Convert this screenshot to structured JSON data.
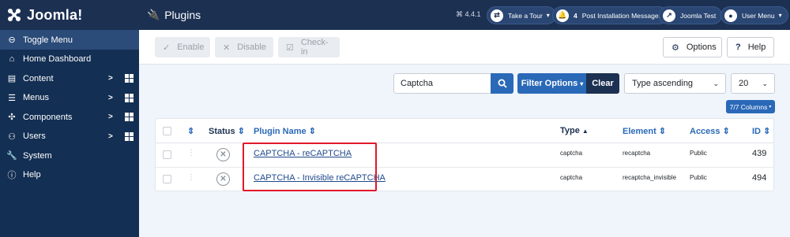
{
  "app": {
    "logo_text": "Joomla!",
    "page_title": "Plugins",
    "version": "⌘ 4.4.1"
  },
  "header_buttons": {
    "tour": "Take a Tour",
    "post_install_count": "4",
    "post_install": "Post Installation Messages",
    "site": "Joomla Test",
    "user_menu": "User Menu"
  },
  "sidebar": {
    "items": [
      {
        "label": "Toggle Menu",
        "icon": "toggle-icon"
      },
      {
        "label": "Home Dashboard",
        "icon": "home-icon"
      },
      {
        "label": "Content",
        "icon": "file-icon"
      },
      {
        "label": "Menus",
        "icon": "list-icon"
      },
      {
        "label": "Components",
        "icon": "puzzle-icon"
      },
      {
        "label": "Users",
        "icon": "users-icon"
      },
      {
        "label": "System",
        "icon": "wrench-icon"
      },
      {
        "label": "Help",
        "icon": "info-icon"
      }
    ]
  },
  "toolbar": {
    "enable": "Enable",
    "disable": "Disable",
    "checkin": "Check-in",
    "options": "Options",
    "help": "Help"
  },
  "filters": {
    "search_value": "Captcha",
    "filter_options": "Filter Options",
    "clear": "Clear",
    "sort": "Type ascending",
    "limit": "20",
    "columns": "7/7 Columns"
  },
  "table": {
    "headers": {
      "status": "Status",
      "plugin_name": "Plugin Name",
      "type": "Type",
      "element": "Element",
      "access": "Access",
      "id": "ID"
    },
    "rows": [
      {
        "name": "CAPTCHA - reCAPTCHA",
        "type": "captcha",
        "element": "recaptcha",
        "access": "Public",
        "id": "439"
      },
      {
        "name": "CAPTCHA - Invisible reCAPTCHA",
        "type": "captcha",
        "element": "recaptcha_invisible",
        "access": "Public",
        "id": "494"
      }
    ]
  },
  "colors": {
    "header_bg": "#1c3052",
    "sidebar_bg": "#132f53",
    "primary": "#2a69b8",
    "highlight": "#e0182a"
  }
}
